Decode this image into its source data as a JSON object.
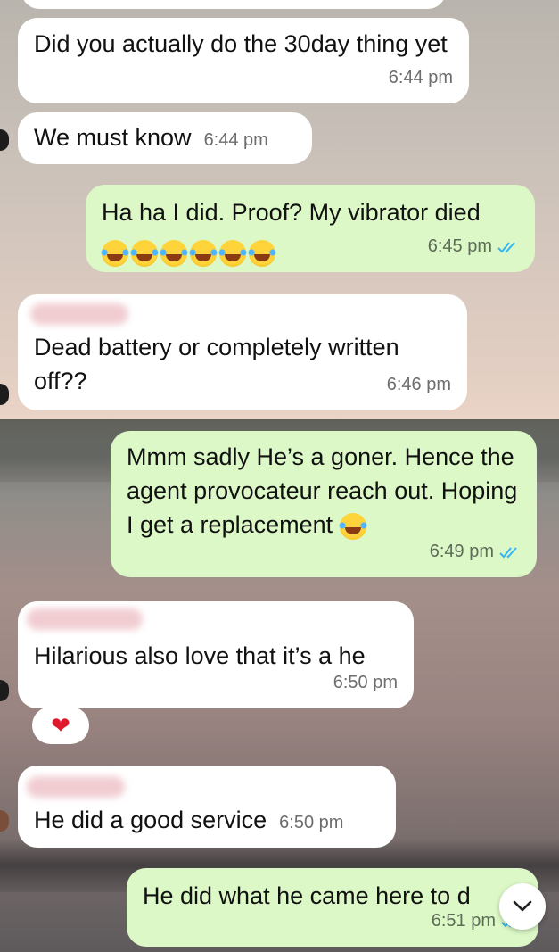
{
  "messages": [
    {
      "text": "Did you actually do the 30day thing yet",
      "time": "6:44 pm",
      "direction": "incoming"
    },
    {
      "text": "We must know",
      "time": "6:44 pm",
      "direction": "incoming"
    },
    {
      "text": "Ha ha I did. Proof? My vibrator died",
      "emoji_count": 6,
      "emoji_name": "tears-of-joy",
      "time": "6:45 pm",
      "direction": "outgoing",
      "status": "read"
    },
    {
      "text": "Dead battery or completely written off??",
      "time": "6:46 pm",
      "direction": "incoming"
    },
    {
      "text": "Mmm sadly He’s a goner. Hence the agent provocateur reach out. Hoping I get a replacement",
      "emoji_name": "tears-of-joy",
      "time": "6:49 pm",
      "direction": "outgoing",
      "status": "read"
    },
    {
      "text": "Hilarious also love that it’s a he",
      "time": "6:50 pm",
      "direction": "incoming",
      "reaction": "red-heart"
    },
    {
      "text": "He did a good service",
      "time": "6:50 pm",
      "direction": "incoming"
    },
    {
      "text": "He did what he came here to d",
      "time": "6:51 pm",
      "direction": "outgoing",
      "status": "read"
    }
  ],
  "colors": {
    "incoming": "#ffffff",
    "outgoing": "#dcf8c6",
    "read_tick": "#34b7f1",
    "heart": "#e0182d"
  },
  "icons": {
    "scroll_down": "chevron-down-icon",
    "read_receipt": "double-check-icon"
  }
}
